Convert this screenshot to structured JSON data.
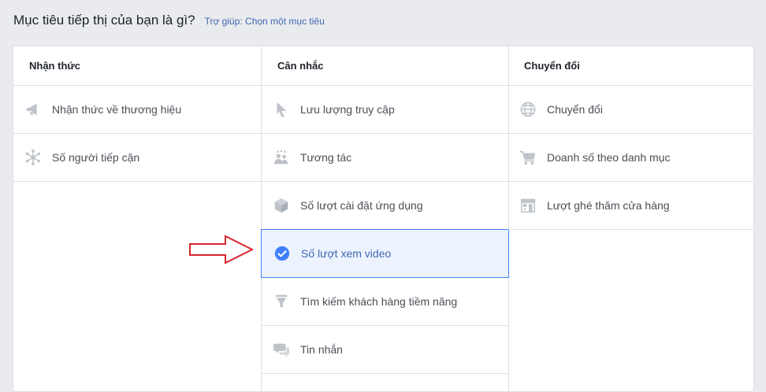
{
  "header": {
    "title": "Mục tiêu tiếp thị của bạn là gì?",
    "help_link": "Trợ giúp: Chọn một mục tiêu"
  },
  "columns": [
    {
      "title": "Nhận thức",
      "items": [
        {
          "label": "Nhận thức về thương hiệu",
          "icon": "megaphone-icon"
        },
        {
          "label": "Số người tiếp cận",
          "icon": "reach-network-icon"
        }
      ]
    },
    {
      "title": "Cân nhắc",
      "items": [
        {
          "label": "Lưu lượng truy cập",
          "icon": "cursor-icon"
        },
        {
          "label": "Tương tác",
          "icon": "people-icon"
        },
        {
          "label": "Số lượt cài đặt ứng dụng",
          "icon": "box-icon"
        },
        {
          "label": "Số lượt xem video",
          "icon": "check-circle-icon",
          "selected": true
        },
        {
          "label": "Tìm kiếm khách hàng tiềm năng",
          "icon": "funnel-icon"
        },
        {
          "label": "Tin nhắn",
          "icon": "chat-bubbles-icon"
        }
      ]
    },
    {
      "title": "Chuyển đổi",
      "items": [
        {
          "label": "Chuyển đổi",
          "icon": "globe-icon"
        },
        {
          "label": "Doanh số theo danh mục",
          "icon": "cart-icon"
        },
        {
          "label": "Lượt ghé thăm cửa hàng",
          "icon": "store-icon"
        }
      ]
    }
  ],
  "colors": {
    "icon_gray": "#bec3c9",
    "accent": "#4080ff",
    "selected_bg": "#ecf3ff",
    "arrow_red": "#d9262e"
  }
}
